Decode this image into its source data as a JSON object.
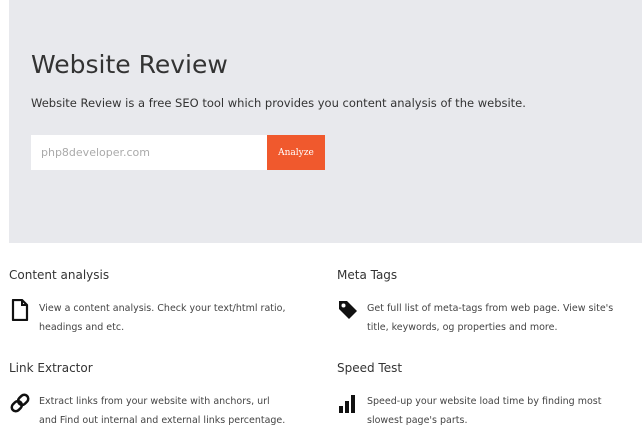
{
  "hero": {
    "title": "Website Review",
    "description": "Website Review is a free SEO tool which provides you content analysis of the website.",
    "search_placeholder": "php8developer.com",
    "analyze_label": "Analyze"
  },
  "features": [
    {
      "title": "Content analysis",
      "text": "View a content analysis. Check your text/html ratio, headings and etc.",
      "icon": "document-icon"
    },
    {
      "title": "Meta Tags",
      "text": "Get full list of meta-tags from web page. View site's title, keywords, og properties and more.",
      "icon": "tag-icon"
    },
    {
      "title": "Link Extractor",
      "text": "Extract links from your website with anchors, url and Find out internal and external links percentage.",
      "icon": "link-icon"
    },
    {
      "title": "Speed Test",
      "text": "Speed-up your website load time by finding most slowest page's parts.",
      "icon": "bar-chart-icon"
    }
  ],
  "colors": {
    "accent": "#f0592d",
    "hero_bg": "#e8e9ed"
  }
}
